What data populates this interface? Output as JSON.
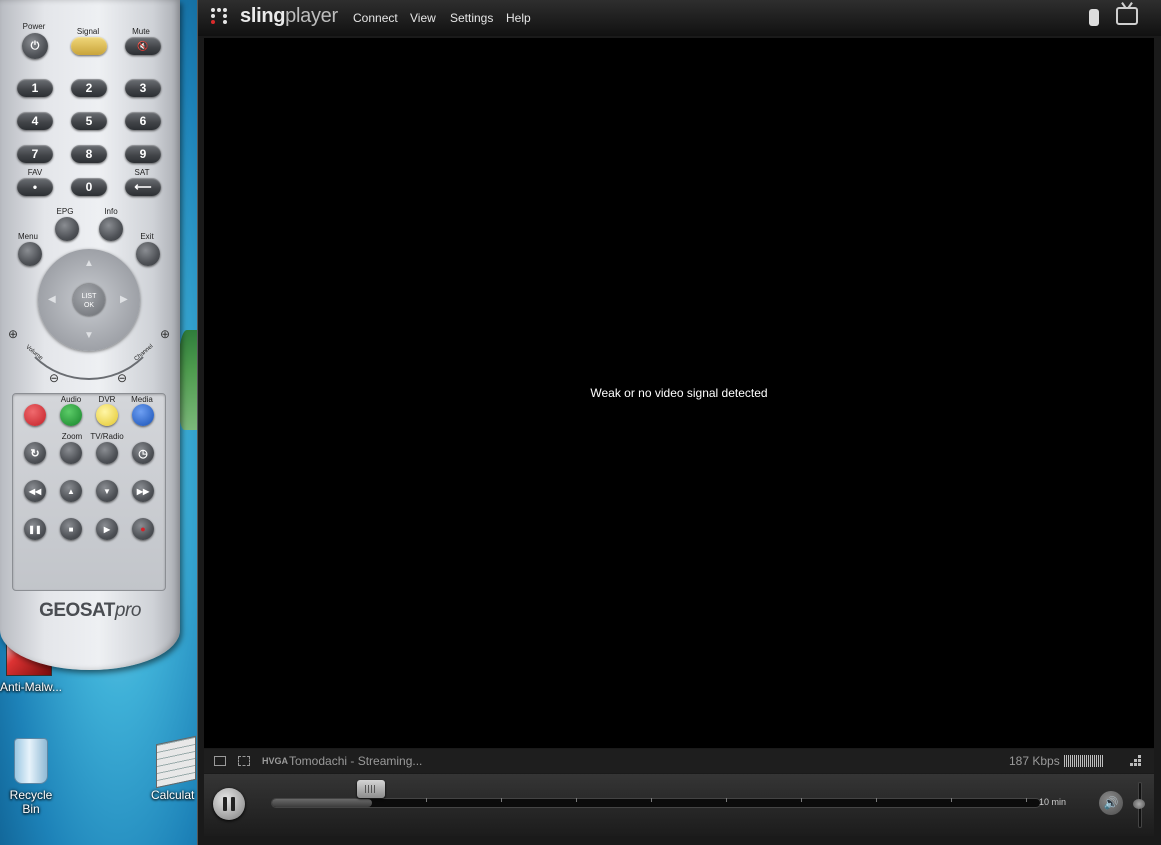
{
  "desktop": {
    "icons": [
      {
        "label": "Anti-Malw...",
        "icon": "anti-malware-icon"
      },
      {
        "label": "Recycle Bin",
        "icon": "recycle-bin-icon"
      },
      {
        "label": "Calculat",
        "icon": "calculator-icon"
      }
    ]
  },
  "remote": {
    "brand_main": "GEOSAT",
    "brand_suffix": "pro",
    "top_labels": {
      "power": "Power",
      "signal": "Signal",
      "mute": "Mute"
    },
    "digits": [
      "1",
      "2",
      "3",
      "4",
      "5",
      "6",
      "7",
      "8",
      "9",
      "0"
    ],
    "fav_label": "FAV",
    "sat_label": "SAT",
    "epg_label": "EPG",
    "info_label": "Info",
    "menu_label": "Menu",
    "exit_label": "Exit",
    "ok_label": "LIST\nOK",
    "volume_label": "Volume",
    "channel_label": "Channel",
    "audio_label": "Audio",
    "dvr_label": "DVR",
    "media_label": "Media",
    "zoom_label": "Zoom",
    "tvradio_label": "TV/Radio",
    "colors": {
      "red": "#d2232a",
      "green": "#1f8f2d",
      "yellow": "#f1dc3c",
      "blue": "#1d5fbf",
      "signal": "#d9b64a"
    }
  },
  "player": {
    "logo_bold": "sling",
    "logo_light": "player",
    "menu": {
      "connect": "Connect",
      "view": "View",
      "settings": "Settings",
      "help": "Help"
    },
    "video_message": "Weak or no video signal detected",
    "status": {
      "resolution": "HVGA",
      "title": "Tomodachi - Streaming...",
      "bitrate": "187 Kbps"
    },
    "playback": {
      "buffer_label": "10 min",
      "progress_fraction": 0.13
    }
  }
}
